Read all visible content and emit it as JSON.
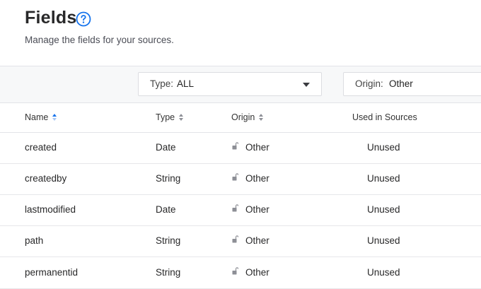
{
  "header": {
    "title": "Fields",
    "subtitle": "Manage the fields for your sources."
  },
  "filters": {
    "type": {
      "label": "Type:",
      "value": "ALL"
    },
    "origin": {
      "label": "Origin:",
      "value": "Other"
    }
  },
  "table": {
    "columns": [
      "Name",
      "Type",
      "Origin",
      "Used in Sources"
    ],
    "rows": [
      {
        "name": "created",
        "type": "Date",
        "origin": "Other",
        "used": "Unused"
      },
      {
        "name": "createdby",
        "type": "String",
        "origin": "Other",
        "used": "Unused"
      },
      {
        "name": "lastmodified",
        "type": "Date",
        "origin": "Other",
        "used": "Unused"
      },
      {
        "name": "path",
        "type": "String",
        "origin": "Other",
        "used": "Unused"
      },
      {
        "name": "permanentid",
        "type": "String",
        "origin": "Other",
        "used": "Unused"
      }
    ]
  },
  "colors": {
    "accent": "#1372ec",
    "text": "#282829",
    "border": "#e3e4e8"
  },
  "icons": {
    "help": "question-circle-icon",
    "sort": "sort-arrows-icon",
    "lock": "unlocked-padlock-icon",
    "caret": "chevron-down-icon"
  }
}
